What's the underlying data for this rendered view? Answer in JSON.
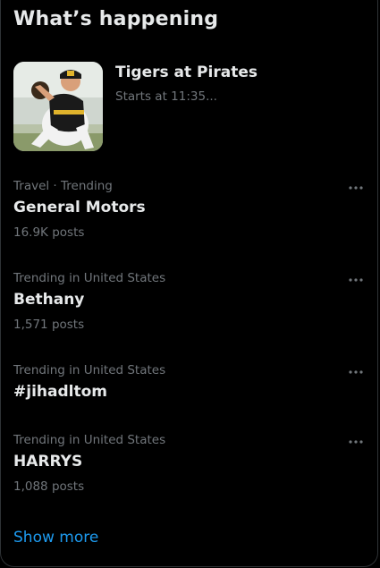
{
  "section": {
    "title": "What’s happening",
    "show_more": "Show more"
  },
  "event": {
    "title": "Tigers at Pirates",
    "subtitle": "Starts at 11:35..."
  },
  "trends": [
    {
      "meta": "Travel · Trending",
      "name": "General Motors",
      "posts": "16.9K posts"
    },
    {
      "meta": "Trending in United States",
      "name": "Bethany",
      "posts": "1,571 posts"
    },
    {
      "meta": "Trending in United States",
      "name": "#jihadltom",
      "posts": ""
    },
    {
      "meta": "Trending in United States",
      "name": "HARRYS",
      "posts": "1,088 posts"
    }
  ],
  "colors": {
    "background": "#000000",
    "primary_text": "#e7e9ea",
    "secondary_text": "#71767b",
    "accent": "#1d9bf0"
  },
  "icons": {
    "more": "more-horizontal-icon"
  }
}
